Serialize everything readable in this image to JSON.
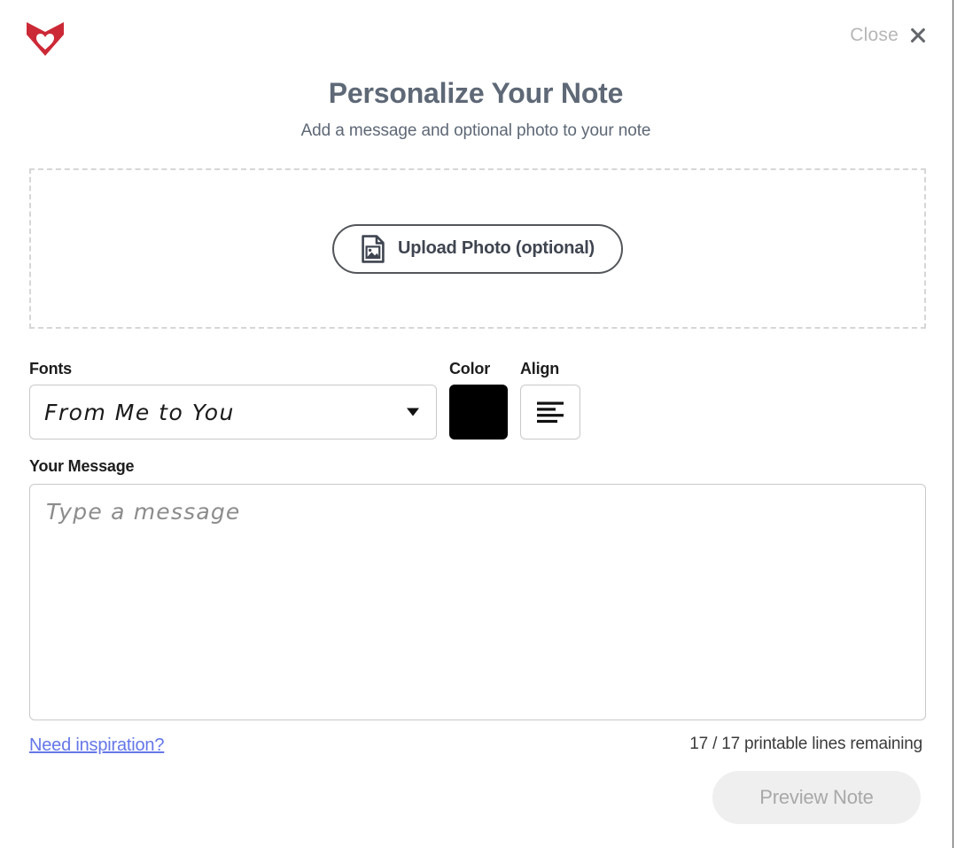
{
  "brand": {
    "logo_name": "hallmark-crown-heart-logo",
    "logo_color": "#cc2936"
  },
  "header": {
    "close_label": "Close",
    "close_icon": "close-x-icon"
  },
  "titles": {
    "heading": "Personalize Your Note",
    "subheading": "Add a message and optional photo to your note",
    "heading_color": "#5e6876"
  },
  "upload": {
    "button_label": "Upload Photo (optional)",
    "icon": "document-image-icon",
    "dropzone_border_color": "#d6d6d6"
  },
  "controls": {
    "fonts_label": "Fonts",
    "font_selected": "From Me to You",
    "font_caret_icon": "chevron-down-icon",
    "color_label": "Color",
    "color_value": "#000000",
    "align_label": "Align",
    "align_icon": "align-left-icon"
  },
  "message": {
    "label": "Your Message",
    "placeholder": "Type a message",
    "value": ""
  },
  "footer": {
    "inspiration_link": "Need inspiration?",
    "inspiration_color": "#6577e8",
    "lines_remaining": "17 / 17 printable lines remaining",
    "lines_used": 0,
    "lines_total": 17,
    "preview_label": "Preview Note",
    "preview_disabled": true
  }
}
